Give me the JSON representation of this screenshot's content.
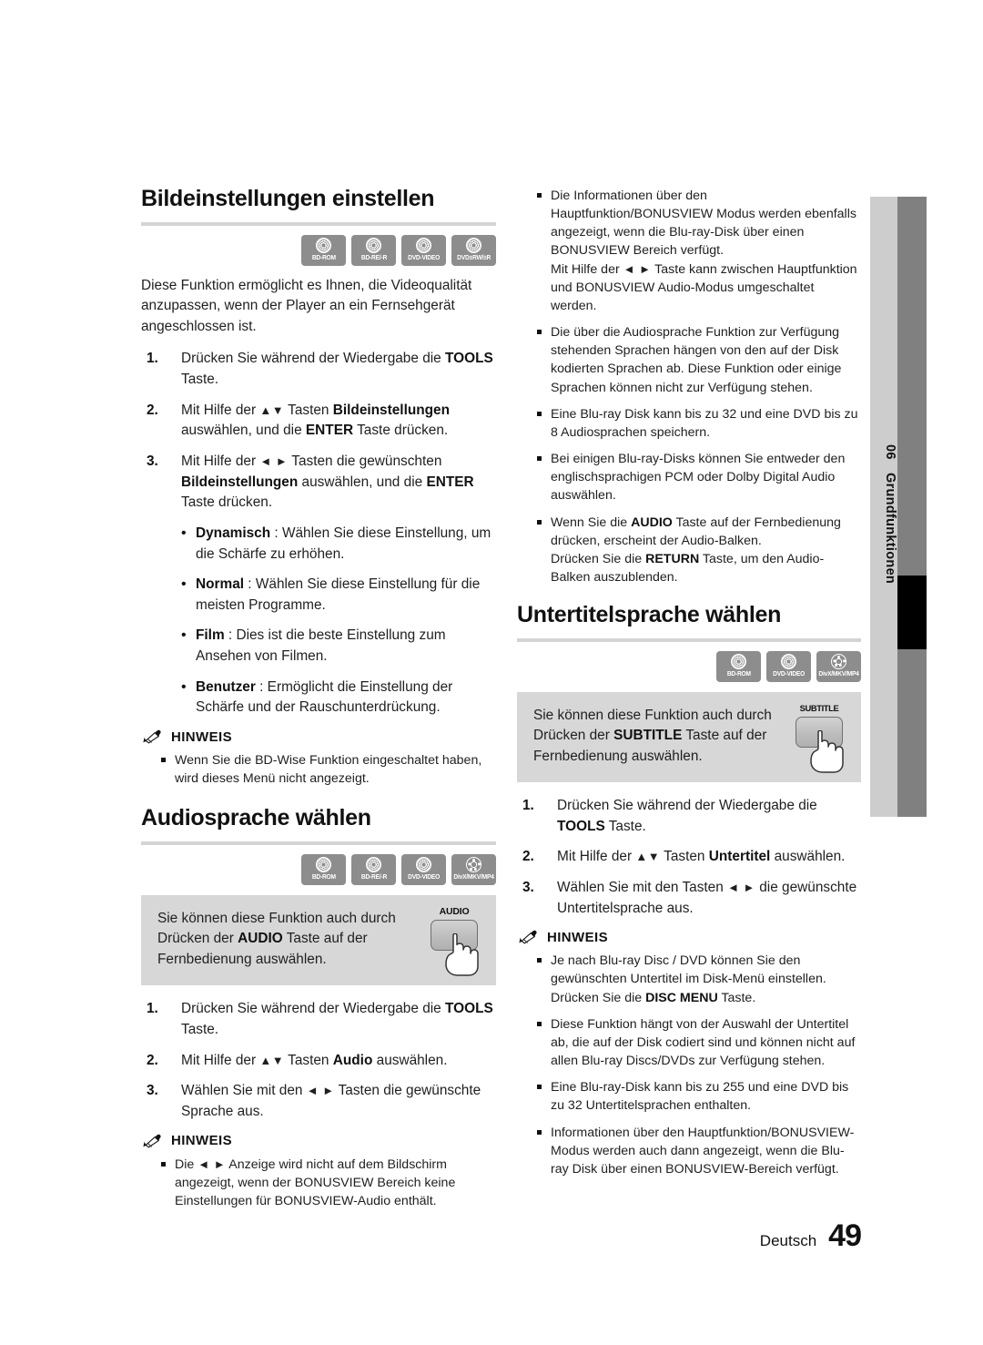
{
  "footer": {
    "language": "Deutsch",
    "page_number": "49"
  },
  "side_tab": {
    "chapter_number": "06",
    "chapter_title": "Grundfunktionen"
  },
  "left_column": {
    "section1": {
      "heading": "Bildeinstellungen einstellen",
      "badges": [
        {
          "label": "BD-ROM",
          "icon": "disc-icon"
        },
        {
          "label": "BD-RE/-R",
          "icon": "disc-icon"
        },
        {
          "label": "DVD-VIDEO",
          "icon": "disc-icon"
        },
        {
          "label": "DVD±RW/±R",
          "icon": "disc-icon"
        }
      ],
      "intro": "Diese Funktion ermöglicht es Ihnen, die Videoqualität anzupassen, wenn der Player an ein Fernsehgerät angeschlossen ist.",
      "steps": [
        {
          "num": "1.",
          "text_html": "Drücken Sie während der Wiedergabe die <b>TOOLS</b> Taste."
        },
        {
          "num": "2.",
          "text_html": "Mit Hilfe der <span class=\"arrows\">▲▼</span> Tasten <b>Bildeinstellungen</b> auswählen, und die <b>ENTER</b> Taste drücken."
        },
        {
          "num": "3.",
          "text_html": "Mit Hilfe der <span class=\"arrows\">◄ ►</span> Tasten die gewünschten <b>Bildeinstellungen</b> auswählen, und die <b>ENTER</b> Taste drücken."
        }
      ],
      "options": [
        {
          "term": "Dynamisch",
          "text": " : Wählen Sie diese Einstellung, um die Schärfe zu erhöhen."
        },
        {
          "term": "Normal",
          "text": " : Wählen Sie diese Einstellung für die meisten Programme."
        },
        {
          "term": "Film",
          "text": " : Dies ist die beste Einstellung zum Ansehen von Filmen."
        },
        {
          "term": "Benutzer",
          "text": " : Ermöglicht die Einstellung der Schärfe und der Rauschunterdrückung."
        }
      ],
      "note_title": "HINWEIS",
      "notes": [
        "Wenn Sie die BD-Wise Funktion eingeschaltet haben, wird dieses Menü nicht angezeigt."
      ]
    },
    "section2": {
      "heading": "Audiosprache wählen",
      "badges": [
        {
          "label": "BD-ROM",
          "icon": "disc-icon"
        },
        {
          "label": "BD-RE/-R",
          "icon": "disc-icon"
        },
        {
          "label": "DVD-VIDEO",
          "icon": "disc-icon"
        },
        {
          "label": "DivX/MKV/MP4",
          "icon": "film-disc-icon"
        }
      ],
      "tip_html": "Sie können diese Funktion auch durch Drücken der <b>AUDIO</b> Taste auf der Fernbedienung auswählen.",
      "remote_key_label": "AUDIO",
      "steps": [
        {
          "num": "1.",
          "text_html": "Drücken Sie während der Wiedergabe die <b>TOOLS</b> Taste."
        },
        {
          "num": "2.",
          "text_html": "Mit Hilfe der <span class=\"arrows\">▲▼</span> Tasten <b>Audio</b> auswählen."
        },
        {
          "num": "3.",
          "text_html": "Wählen Sie mit den <span class=\"arrows\">◄ ►</span> Tasten die gewünschte Sprache aus."
        }
      ],
      "note_title": "HINWEIS",
      "notes_html": [
        "Die <span class=\"arrows\">◄ ►</span> Anzeige wird nicht auf dem Bildschirm angezeigt, wenn der BONUSVIEW Bereich keine Einstellungen für BONUSVIEW-Audio enthält."
      ]
    }
  },
  "right_column": {
    "top_notes_html": [
      "Die Informationen über den Hauptfunktion/BONUSVIEW Modus werden ebenfalls angezeigt, wenn die Blu-ray-Disk über einen BONUSVIEW Bereich verfügt.<br>Mit Hilfe der <span class=\"arrows\">◄ ►</span> Taste kann zwischen Hauptfunktion und BONUSVIEW Audio-Modus umgeschaltet werden.",
      "Die über die Audiosprache Funktion zur Verfügung stehenden Sprachen hängen von den auf der Disk kodierten Sprachen ab. Diese Funktion oder einige Sprachen können nicht zur Verfügung stehen.",
      "Eine Blu-ray Disk kann bis zu 32 und eine DVD bis zu 8 Audiosprachen speichern.",
      "Bei einigen Blu-ray-Disks können Sie entweder den englischsprachigen PCM oder Dolby Digital Audio auswählen.",
      "Wenn Sie die <b>AUDIO</b> Taste auf der Fernbedienung drücken, erscheint der Audio-Balken.<br>Drücken Sie die <b>RETURN</b> Taste, um den Audio-Balken auszublenden."
    ],
    "section3": {
      "heading": "Untertitelsprache wählen",
      "badges": [
        {
          "label": "BD-ROM",
          "icon": "disc-icon"
        },
        {
          "label": "DVD-VIDEO",
          "icon": "disc-icon"
        },
        {
          "label": "DivX/MKV/MP4",
          "icon": "film-disc-icon"
        }
      ],
      "tip_html": "Sie können diese Funktion auch durch Drücken der <b>SUBTITLE</b> Taste auf der Fernbedienung auswählen.",
      "remote_key_label": "SUBTITLE",
      "steps": [
        {
          "num": "1.",
          "text_html": "Drücken Sie während der Wiedergabe die <b>TOOLS</b> Taste."
        },
        {
          "num": "2.",
          "text_html": "Mit Hilfe der <span class=\"arrows\">▲▼</span> Tasten <b>Untertitel</b> auswählen."
        },
        {
          "num": "3.",
          "text_html": "Wählen Sie mit den Tasten <span class=\"arrows\">◄ ►</span> die gewünschte Untertitelsprache aus."
        }
      ],
      "note_title": "HINWEIS",
      "notes_html": [
        "Je nach Blu-ray Disc / DVD können Sie den gewünschten Untertitel im Disk-Menü einstellen. Drücken Sie die <b>DISC MENU</b> Taste.",
        "Diese Funktion hängt von der Auswahl der Untertitel ab, die auf der Disk codiert sind und können nicht auf allen Blu-ray Discs/DVDs zur Verfügung stehen.",
        "Eine Blu-ray-Disk kann bis zu 255 und eine DVD bis zu 32 Untertitelsprachen enthalten.",
        "Informationen über den Hauptfunktion/BONUSVIEW-Modus werden auch dann angezeigt, wenn die Blu-ray Disk über einen BONUSVIEW-Bereich verfügt."
      ]
    }
  },
  "colors": {
    "badge_gray": "#8d8d8d",
    "tipbox_gray": "#d7d7d7",
    "rule_gray": "#d4d4d4",
    "tab_light": "#cdcdcd",
    "tab_dark": "#808080",
    "marker_black": "#000000"
  }
}
